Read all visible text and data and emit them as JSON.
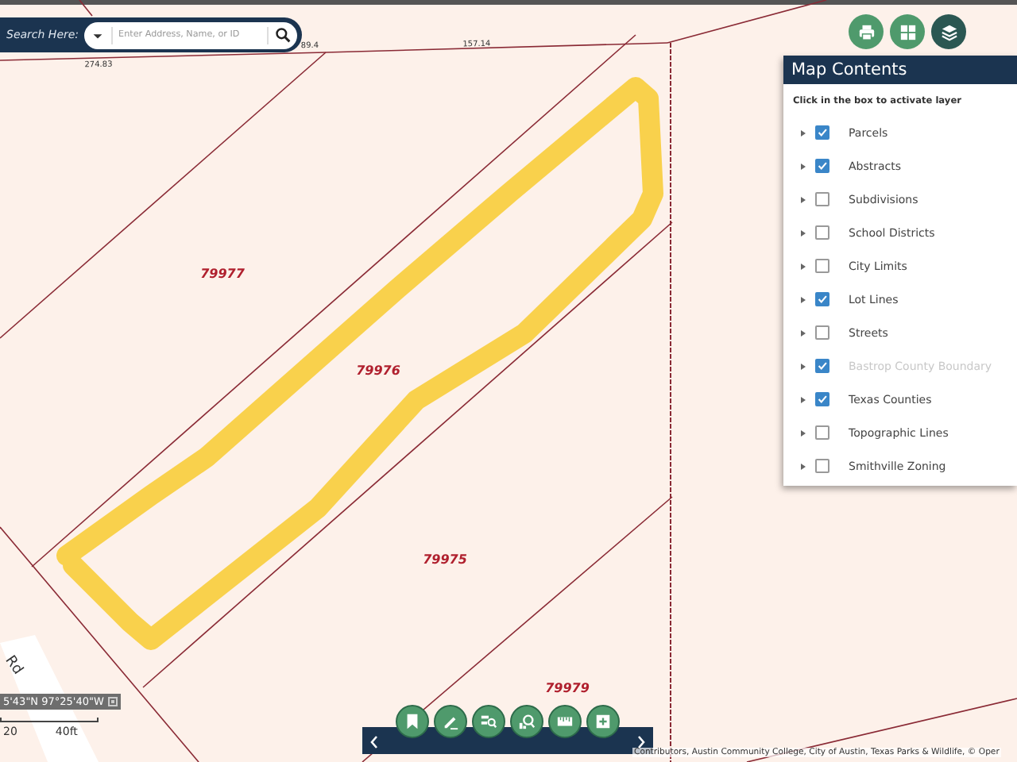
{
  "search": {
    "label": "Search Here:",
    "placeholder": "Enter Address, Name, or ID"
  },
  "map": {
    "parcels": [
      {
        "number": "79977"
      },
      {
        "number": "79976"
      },
      {
        "number": "79975"
      },
      {
        "number": "79979"
      }
    ],
    "line_labels": [
      {
        "text": "274.83"
      },
      {
        "text": "89.4"
      },
      {
        "text": "157.14"
      }
    ],
    "road_label": "Rd"
  },
  "layers_panel": {
    "title": "Map Contents",
    "hint": "Click in the box to activate layer",
    "layers": [
      {
        "name": "Parcels",
        "checked": true,
        "disabled": false
      },
      {
        "name": "Abstracts",
        "checked": true,
        "disabled": false
      },
      {
        "name": "Subdivisions",
        "checked": false,
        "disabled": false
      },
      {
        "name": "School Districts",
        "checked": false,
        "disabled": false
      },
      {
        "name": "City Limits",
        "checked": false,
        "disabled": false
      },
      {
        "name": "Lot Lines",
        "checked": true,
        "disabled": false
      },
      {
        "name": "Streets",
        "checked": false,
        "disabled": false
      },
      {
        "name": "Bastrop County Boundary",
        "checked": true,
        "disabled": true
      },
      {
        "name": "Texas Counties",
        "checked": true,
        "disabled": false
      },
      {
        "name": "Topographic Lines",
        "checked": false,
        "disabled": false
      },
      {
        "name": "Smithville Zoning",
        "checked": false,
        "disabled": false
      }
    ]
  },
  "coordinates": "5'43\"N 97°25'40\"W",
  "scale": {
    "labels": [
      "20",
      "40ft"
    ]
  },
  "attribution": "Contributors, Austin Community College, City of Austin, Texas Parks & Wildlife, © Oper"
}
